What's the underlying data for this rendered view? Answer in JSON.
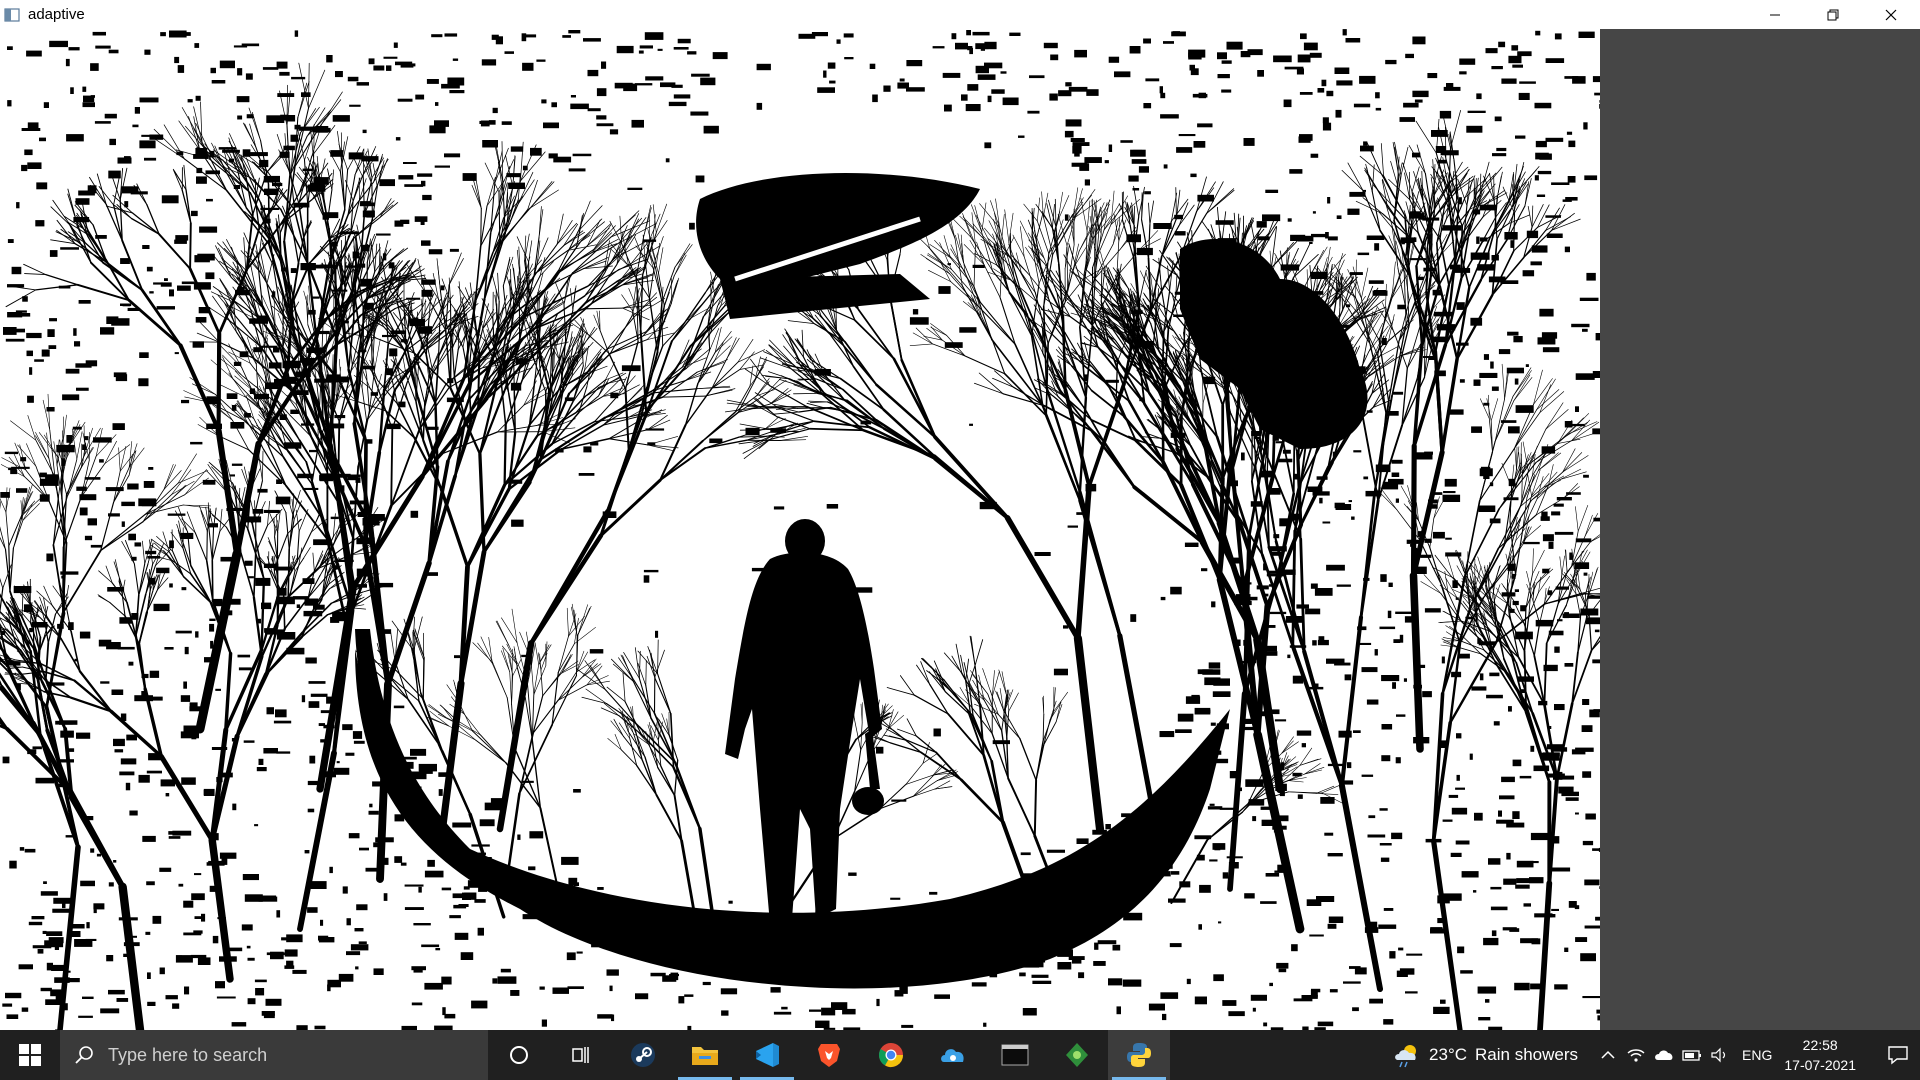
{
  "window": {
    "title": "adaptive",
    "controls": [
      "minimize",
      "restore",
      "close"
    ]
  },
  "image": {
    "description_icon": "thresholded-forest-skull-image",
    "colors": {
      "fg": "#000000",
      "bg": "#ffffff",
      "side_pane": "#464646"
    }
  },
  "taskbar": {
    "search_placeholder": "Type here to search",
    "pinned_apps": [
      {
        "name": "cortana-icon"
      },
      {
        "name": "task-view-icon"
      },
      {
        "name": "steam-icon"
      },
      {
        "name": "file-explorer-icon",
        "active": true
      },
      {
        "name": "vscode-icon",
        "active": true
      },
      {
        "name": "brave-icon"
      },
      {
        "name": "chrome-icon"
      },
      {
        "name": "cloud-app-icon"
      },
      {
        "name": "terminal-icon"
      },
      {
        "name": "green-app-icon"
      },
      {
        "name": "python-icon",
        "active": true,
        "selected": true
      }
    ],
    "weather": {
      "temp": "23°C",
      "desc": "Rain showers"
    },
    "language": "ENG",
    "time": "22:58",
    "date": "17-07-2021",
    "accent": "#76b9ed"
  }
}
